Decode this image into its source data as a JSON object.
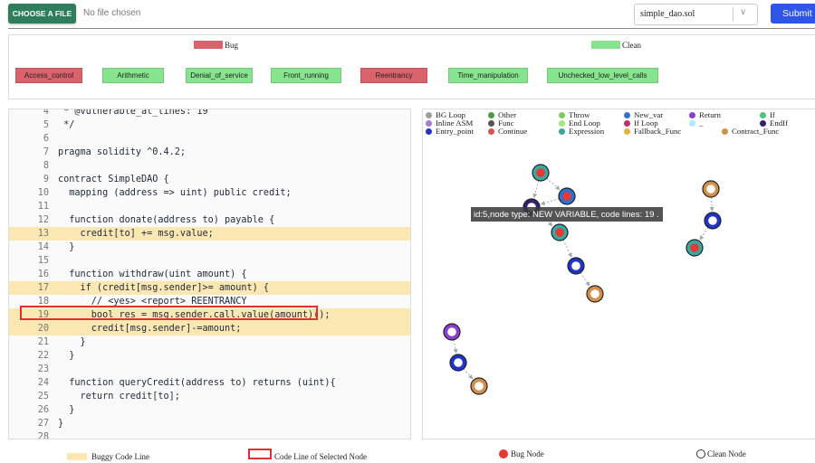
{
  "top": {
    "choose_file_label": "CHOOSE A FILE",
    "file_status": "No file chosen",
    "selected_file": "simple_dao.sol",
    "submit_label": "Submit"
  },
  "legend": {
    "bug_label": "Bug",
    "clean_label": "Clean",
    "colors": {
      "bug": "#d9626c",
      "clean": "#86e38e"
    },
    "vulnerabilities": [
      {
        "label": "Access_control",
        "status": "bug"
      },
      {
        "label": "Arithmetic",
        "status": "clean"
      },
      {
        "label": "Denial_of_service",
        "status": "clean"
      },
      {
        "label": "Front_running",
        "status": "clean"
      },
      {
        "label": "Reentrancy",
        "status": "bug"
      },
      {
        "label": "Time_manipulation",
        "status": "clean"
      },
      {
        "label": "Unchecked_low_level_calls",
        "status": "clean"
      }
    ]
  },
  "code": {
    "lines": [
      {
        "n": "4",
        "text": " * @vulnerable_at_lines: 19"
      },
      {
        "n": "5",
        "text": " */"
      },
      {
        "n": "6",
        "text": ""
      },
      {
        "n": "7",
        "text": "pragma solidity ^0.4.2;"
      },
      {
        "n": "8",
        "text": ""
      },
      {
        "n": "9",
        "text": "contract SimpleDAO {"
      },
      {
        "n": "10",
        "text": "  mapping (address => uint) public credit;"
      },
      {
        "n": "11",
        "text": ""
      },
      {
        "n": "12",
        "text": "  function donate(address to) payable {"
      },
      {
        "n": "13",
        "text": "    credit[to] += msg.value;"
      },
      {
        "n": "14",
        "text": "  }"
      },
      {
        "n": "15",
        "text": ""
      },
      {
        "n": "16",
        "text": "  function withdraw(uint amount) {"
      },
      {
        "n": "17",
        "text": "    if (credit[msg.sender]>= amount) {"
      },
      {
        "n": "18",
        "text": "      // <yes> <report> REENTRANCY"
      },
      {
        "n": "19",
        "text": "      bool res = msg.sender.call.value(amount)();"
      },
      {
        "n": "20",
        "text": "      credit[msg.sender]-=amount;"
      },
      {
        "n": "21",
        "text": "    }"
      },
      {
        "n": "22",
        "text": "  }"
      },
      {
        "n": "23",
        "text": ""
      },
      {
        "n": "24",
        "text": "  function queryCredit(address to) returns (uint){"
      },
      {
        "n": "25",
        "text": "    return credit[to];"
      },
      {
        "n": "26",
        "text": "  }"
      },
      {
        "n": "27",
        "text": "}"
      },
      {
        "n": "28",
        "text": ""
      }
    ],
    "buggy_lines": [
      "13",
      "17",
      "19",
      "20"
    ],
    "selected_line": "19"
  },
  "graph": {
    "node_types": [
      {
        "label": "BG Loop",
        "color": "#9e9e9e"
      },
      {
        "label": "Other",
        "color": "#4e9a3c"
      },
      {
        "label": "Throw",
        "color": "#7ccc5c"
      },
      {
        "label": "New_var",
        "color": "#2f6fd0"
      },
      {
        "label": "Return",
        "color": "#8a3fd1"
      },
      {
        "label": "If",
        "color": "#4fc27d"
      },
      {
        "label": "Inline ASM",
        "color": "#a77ad0"
      },
      {
        "label": "Func",
        "color": "#555555"
      },
      {
        "label": "End Loop",
        "color": "#a6e57e"
      },
      {
        "label": "If Loop",
        "color": "#c2306a"
      },
      {
        "label": "_",
        "color": "#a8eefa"
      },
      {
        "label": "EndIf",
        "color": "#3a1d6e"
      },
      {
        "label": "Entry_point",
        "color": "#2233cc"
      },
      {
        "label": "Continue",
        "color": "#d9544f"
      },
      {
        "label": "Expression",
        "color": "#3aa8a0"
      },
      {
        "label": "Fallback_Func",
        "color": "#e2b23a"
      },
      {
        "label": "Contract_Func",
        "color": "#d2904a"
      }
    ],
    "nodes": [
      {
        "id": "n1",
        "ring": "#3aa8a0",
        "inner": "#e53935"
      },
      {
        "id": "n2",
        "ring": "#2f6fd0",
        "inner": "#e53935"
      },
      {
        "id": "n3",
        "ring": "#3a1d6e",
        "inner": "#ffffff"
      },
      {
        "id": "n4",
        "ring": "#3aa8a0",
        "inner": "#e53935"
      },
      {
        "id": "n5",
        "ring": "#2233cc",
        "inner": "#ffffff"
      },
      {
        "id": "n6",
        "ring": "#d2904a",
        "inner": "#ffffff"
      },
      {
        "id": "n7",
        "ring": "#d2904a",
        "inner": "#ffffff"
      },
      {
        "id": "n8",
        "ring": "#2233cc",
        "inner": "#ffffff"
      },
      {
        "id": "n9",
        "ring": "#3aa8a0",
        "inner": "#e53935"
      },
      {
        "id": "n10",
        "ring": "#8a3fd1",
        "inner": "#ffffff"
      },
      {
        "id": "n11",
        "ring": "#2233cc",
        "inner": "#ffffff"
      },
      {
        "id": "n12",
        "ring": "#d2904a",
        "inner": "#ffffff"
      }
    ],
    "edges": [
      [
        "n1",
        "n2"
      ],
      [
        "n1",
        "n3"
      ],
      [
        "n2",
        "n3"
      ],
      [
        "n3",
        "n4"
      ],
      [
        "n4",
        "n5"
      ],
      [
        "n5",
        "n6"
      ],
      [
        "n7",
        "n8"
      ],
      [
        "n8",
        "n9"
      ],
      [
        "n10",
        "n11"
      ],
      [
        "n11",
        "n12"
      ]
    ],
    "tooltip": "id:5,node type: NEW VARIABLE, code lines: 19 ."
  },
  "bottom_legend": {
    "buggy_line": "Buggy Code Line",
    "selected_line": "Code Line of Selected Node",
    "bug_node": "Bug Node",
    "clean_node": "Clean Node"
  }
}
